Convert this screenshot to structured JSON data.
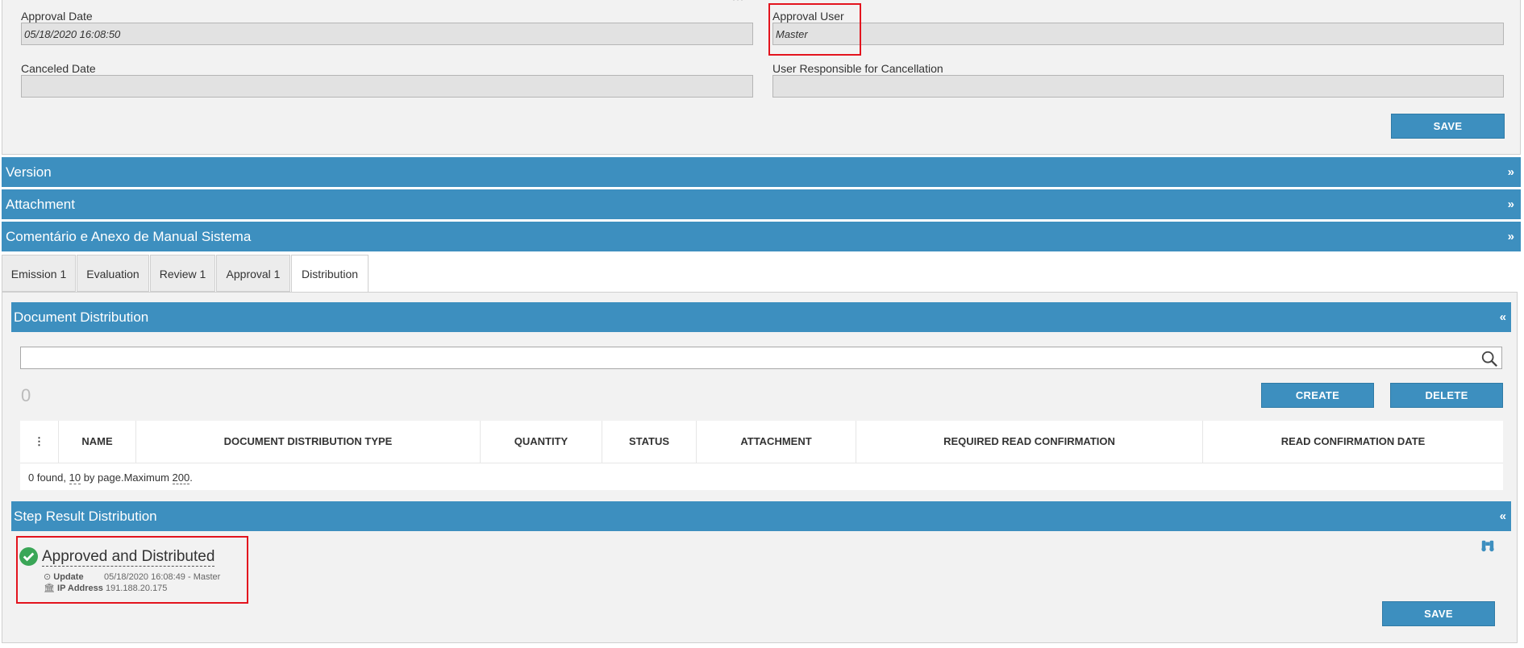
{
  "approval": {
    "date_label": "Approval Date",
    "date_value": "05/18/2020 16:08:50",
    "user_label": "Approval User",
    "user_value": "Master",
    "canceled_label": "Canceled Date",
    "canceled_value": "",
    "cancel_user_label": "User Responsible for Cancellation",
    "cancel_user_value": "",
    "save_label": "SAVE"
  },
  "accordions": [
    {
      "label": "Version",
      "arrow": "»"
    },
    {
      "label": "Attachment",
      "arrow": "»"
    },
    {
      "label": "Comentário e Anexo de Manual Sistema",
      "arrow": "»"
    }
  ],
  "tabs": [
    {
      "label": "Emission 1"
    },
    {
      "label": "Evaluation"
    },
    {
      "label": "Review 1"
    },
    {
      "label": "Approval 1"
    },
    {
      "label": "Distribution",
      "active": true
    }
  ],
  "distribution": {
    "title": "Document Distribution",
    "arrow": "«",
    "search_value": "",
    "count": "0",
    "create_label": "CREATE",
    "delete_label": "DELETE",
    "columns": [
      "⋮",
      "NAME",
      "DOCUMENT DISTRIBUTION TYPE",
      "QUANTITY",
      "STATUS",
      "ATTACHMENT",
      "REQUIRED READ CONFIRMATION",
      "READ CONFIRMATION DATE"
    ],
    "footer_found": "0 found, ",
    "footer_per_page": "10",
    "footer_mid": " by page.Maximum ",
    "footer_max": "200",
    "footer_end": "."
  },
  "step_result": {
    "title": "Step Result Distribution",
    "arrow": "«",
    "result_label": "Approved and Distributed",
    "update_label": "Update",
    "update_value": "05/18/2020 16:08:49 - Master",
    "ip_label": "IP Address",
    "ip_value": "191.188.20.175",
    "save_label": "SAVE"
  },
  "colors": {
    "accent": "#3d8fbf",
    "highlight": "#e3141e",
    "success": "#3aa657"
  }
}
